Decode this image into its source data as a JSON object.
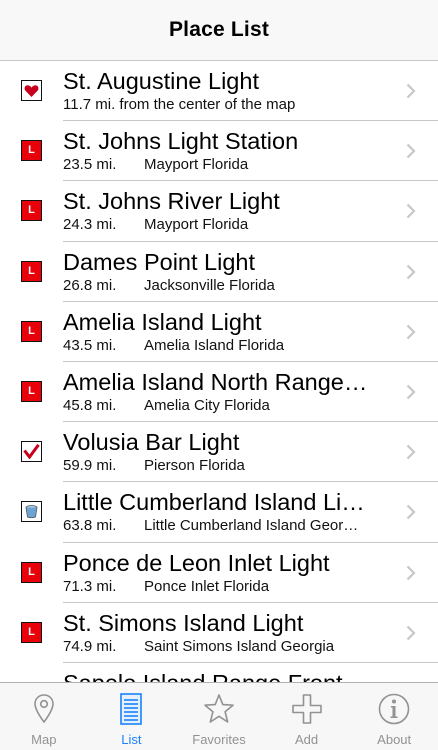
{
  "header": {
    "title": "Place List"
  },
  "places": [
    {
      "name": "St. Augustine Light",
      "distance": "11.7 mi. from the center of the map",
      "location": "",
      "icon": "heart-icon"
    },
    {
      "name": "St. Johns Light Station",
      "distance": "23.5 mi.",
      "location": "Mayport Florida",
      "icon": "lighthouse-icon"
    },
    {
      "name": "St. Johns River Light",
      "distance": "24.3 mi.",
      "location": "Mayport Florida",
      "icon": "lighthouse-icon"
    },
    {
      "name": "Dames Point Light",
      "distance": "26.8 mi.",
      "location": "Jacksonville Florida",
      "icon": "lighthouse-icon"
    },
    {
      "name": "Amelia Island Light",
      "distance": "43.5 mi.",
      "location": "Amelia Island Florida",
      "icon": "lighthouse-icon"
    },
    {
      "name": "Amelia Island North Range…",
      "distance": "45.8 mi.",
      "location": "Amelia City Florida",
      "icon": "lighthouse-icon"
    },
    {
      "name": "Volusia Bar Light",
      "distance": "59.9 mi.",
      "location": "Pierson Florida",
      "icon": "checkmark-icon"
    },
    {
      "name": "Little Cumberland Island Li…",
      "distance": "63.8 mi.",
      "location": "Little Cumberland Island Geor…",
      "icon": "bucket-icon"
    },
    {
      "name": "Ponce de Leon Inlet Light",
      "distance": "71.3 mi.",
      "location": "Ponce Inlet Florida",
      "icon": "lighthouse-icon"
    },
    {
      "name": "St. Simons Island Light",
      "distance": "74.9 mi.",
      "location": "Saint Simons Island Georgia",
      "icon": "lighthouse-icon"
    },
    {
      "name": "Sapelo Island Range Front",
      "distance": "",
      "location": "",
      "icon": "lighthouse-icon"
    }
  ],
  "icon_letter": "L",
  "tabs": [
    {
      "label": "Map",
      "icon": "map-pin-icon",
      "active": false
    },
    {
      "label": "List",
      "icon": "list-icon",
      "active": true
    },
    {
      "label": "Favorites",
      "icon": "star-icon",
      "active": false
    },
    {
      "label": "Add",
      "icon": "plus-icon",
      "active": false
    },
    {
      "label": "About",
      "icon": "info-icon",
      "active": false
    }
  ],
  "colors": {
    "accent": "#1a82fb",
    "inactive": "#929292",
    "marker_red": "#e8000b",
    "heart": "#c8001e"
  }
}
